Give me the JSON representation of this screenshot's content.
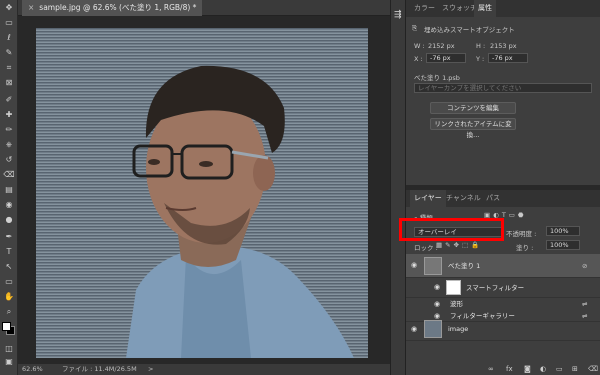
{
  "document": {
    "tab_title": "sample.jpg @ 62.6% (べた塗り 1, RGB/8) *",
    "close_label": "×"
  },
  "status": {
    "zoom": "62.6%",
    "file_info": "ファイル : 11.4M/26.5M",
    "arrow": ">"
  },
  "toolbar": {
    "icons": [
      "move-icon",
      "marquee-icon",
      "lasso-icon",
      "quick-select-icon",
      "crop-icon",
      "frame-icon",
      "eyedropper-icon",
      "spot-heal-icon",
      "brush-icon",
      "stamp-icon",
      "history-brush-icon",
      "eraser-icon",
      "gradient-icon",
      "blur-icon",
      "dodge-icon",
      "pen-icon",
      "type-icon",
      "path-select-icon",
      "shape-icon",
      "hand-icon",
      "zoom-icon",
      "more-icon"
    ],
    "glyphs": [
      "✥",
      "▭",
      "ℓ",
      "✎",
      "⌗",
      "⊠",
      "✐",
      "✚",
      "✏",
      "⎈",
      "↺",
      "⌫",
      "▤",
      "◉",
      "●",
      "✒",
      "T",
      "↖",
      "▭",
      "✋",
      "⌕",
      "…"
    ]
  },
  "properties_panel": {
    "tabs": [
      "カラー",
      "スウォッチ",
      "属性"
    ],
    "active_tab": "属性",
    "object_type": "埋め込みスマートオブジェクト",
    "w_label": "W :",
    "w_value": "2152 px",
    "h_label": "H :",
    "h_value": "2153 px",
    "x_label": "X :",
    "x_value": "-76 px",
    "y_label": "Y :",
    "y_value": "-76 px",
    "source_file": "べた塗り 1.psb",
    "layer_comp_placeholder": "レイヤーカンプを選択してください",
    "edit_contents_button": "コンテンツを編集",
    "convert_linked_button": "リンクされたアイテムに変換..."
  },
  "layers_panel": {
    "tabs": [
      "レイヤー",
      "チャンネル",
      "パス"
    ],
    "active_tab": "レイヤー",
    "filter_kind": "種類",
    "blend_mode": "オーバーレイ",
    "opacity_label": "不透明度 :",
    "opacity_value": "100%",
    "lock_label": "ロック :",
    "fill_label": "塗り :",
    "fill_value": "100%",
    "layers": [
      {
        "name": "べた塗り 1",
        "selected": true
      },
      {
        "name": "スマートフィルター",
        "selected": false
      },
      {
        "name": "波形",
        "selected": false
      },
      {
        "name": "フィルターギャラリー",
        "selected": false
      },
      {
        "name": "image",
        "selected": false
      }
    ]
  },
  "colors": {
    "highlight": "#ff0000",
    "selected_layer": "#565656",
    "panel_bg": "#3e3e3e"
  }
}
